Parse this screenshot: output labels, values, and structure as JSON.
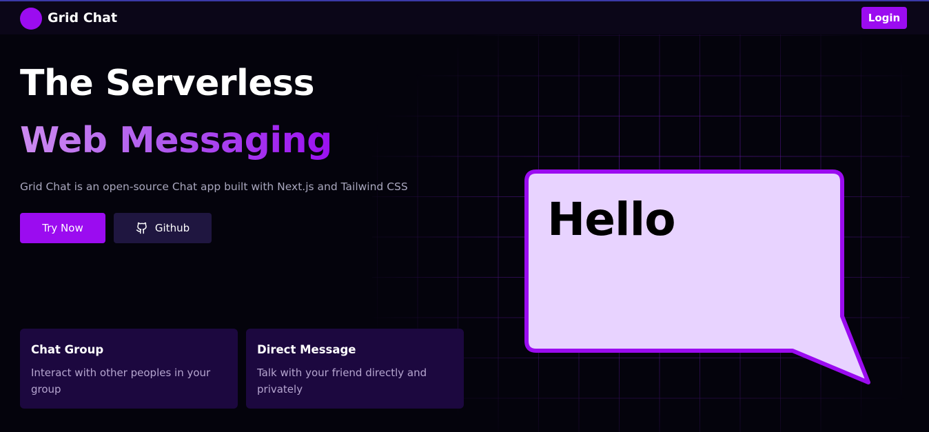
{
  "navbar": {
    "brand": "Grid Chat",
    "login_label": "Login"
  },
  "hero": {
    "title_line1": "The Serverless",
    "title_line2": "Web Messaging",
    "subtitle": "Grid Chat is an open-source Chat app built with Next.js and Tailwind CSS",
    "try_now_label": "Try Now",
    "github_label": "Github"
  },
  "features": [
    {
      "title": "Chat Group",
      "description": "Interact with other peoples in your group"
    },
    {
      "title": "Direct Message",
      "description": "Talk with your friend directly and privately"
    }
  ],
  "bubble": {
    "text": "Hello"
  },
  "icons": {
    "logo": "logo-circle-icon",
    "github": "github-icon"
  },
  "colors": {
    "accent": "#9b0cf0",
    "background": "#04030c",
    "card": "#1c083f",
    "bubble_fill": "#e8d3ff"
  }
}
